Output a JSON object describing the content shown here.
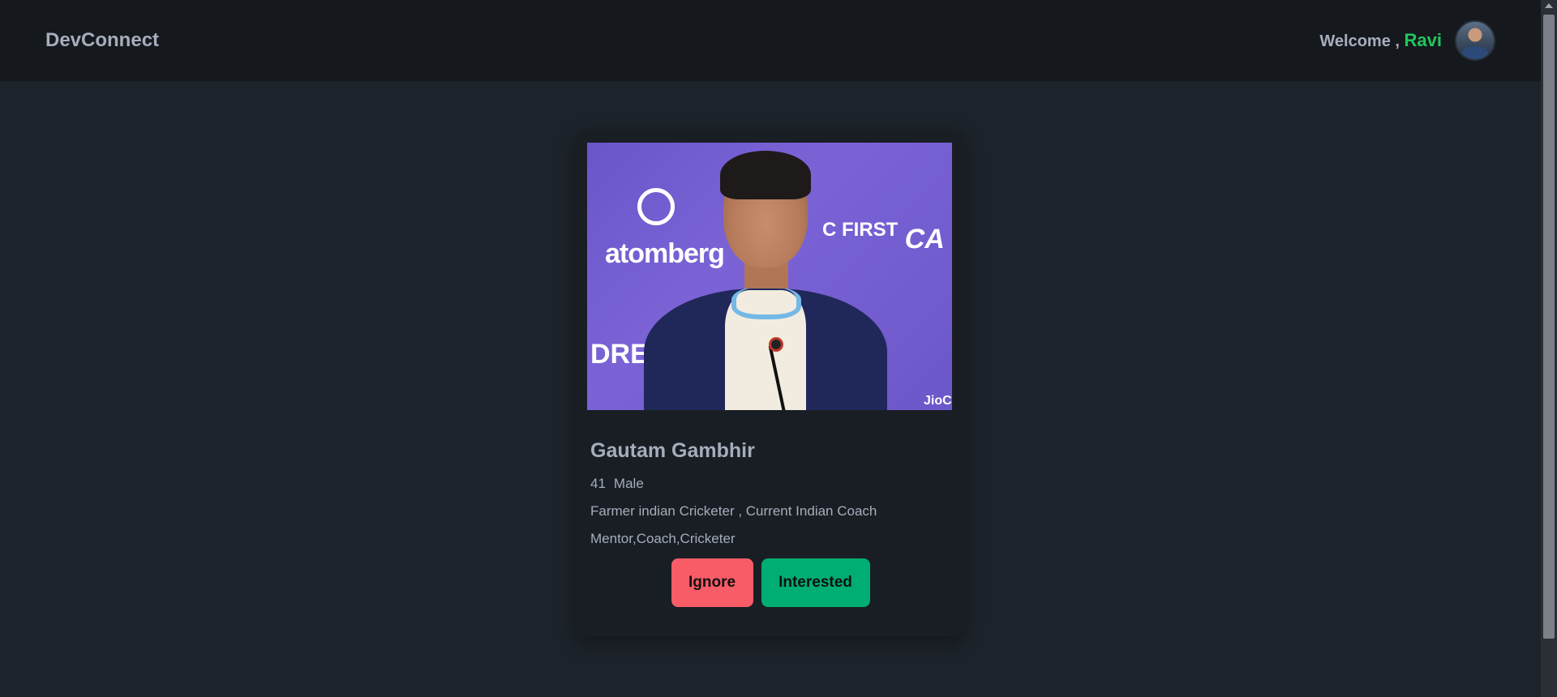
{
  "navbar": {
    "brand": "DevConnect",
    "welcome_prefix": "Welcome ,",
    "user_name": "Ravi"
  },
  "profile_card": {
    "name": "Gautam Gambhir",
    "age": "41",
    "gender": "Male",
    "about": "Farmer indian Cricketer , Current Indian Coach",
    "skills": "Mentor,Coach,Cricketer",
    "photo_backdrop": {
      "sponsor_1": "atomberg",
      "sponsor_2": "C FIRST",
      "sponsor_3": "CA",
      "sponsor_4": "DRE",
      "sponsor_5": "JioC"
    }
  },
  "actions": {
    "ignore_label": "Ignore",
    "interested_label": "Interested"
  },
  "colors": {
    "background": "#1d232a",
    "navbar": "#15191e",
    "card": "#191e24",
    "user_name": "#22c55e",
    "ignore": "#f75c67",
    "interested": "#00ad72"
  }
}
